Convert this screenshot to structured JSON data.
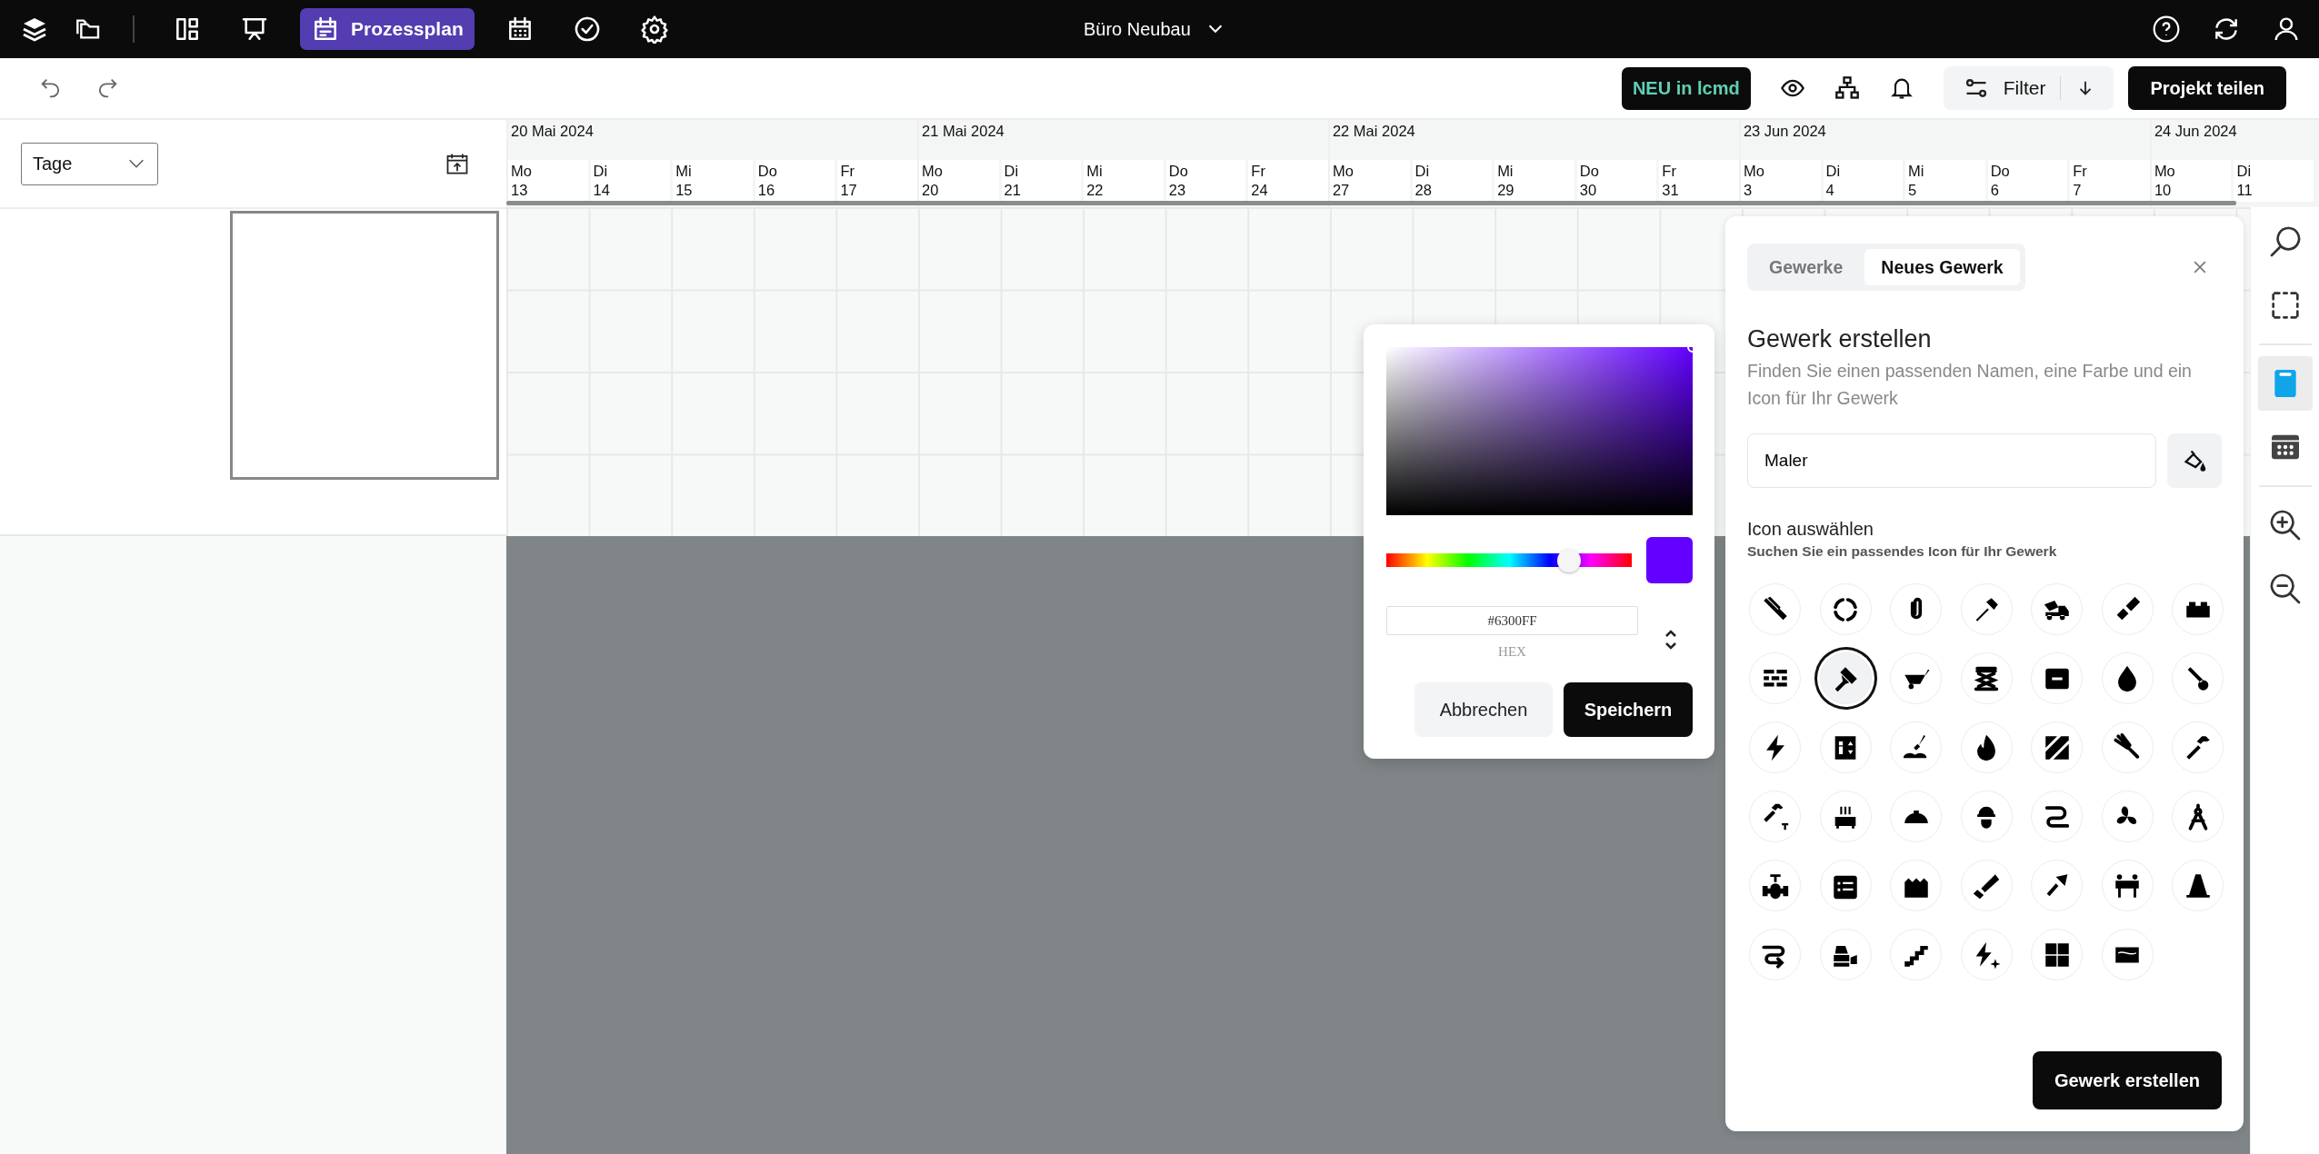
{
  "nav_tabs": [
    {
      "selected": false
    },
    {
      "selected": false
    },
    {
      "label": "Prozessplan",
      "selected": true
    },
    {
      "selected": false
    },
    {
      "selected": false
    },
    {
      "selected": false
    }
  ],
  "project": {
    "name": "Büro Neubau"
  },
  "toolbar": {
    "badge": "NEU in lcmd",
    "filter": "Filter",
    "share": "Projekt teilen"
  },
  "view_select": {
    "value": "Tage"
  },
  "timeline": {
    "weeks": [
      {
        "label": "20 Mai 2024",
        "days": [
          {
            "weekday": "Mo",
            "date": "13"
          },
          {
            "weekday": "Di",
            "date": "14"
          },
          {
            "weekday": "Mi",
            "date": "15"
          },
          {
            "weekday": "Do",
            "date": "16"
          },
          {
            "weekday": "Fr",
            "date": "17"
          }
        ]
      },
      {
        "label": "21 Mai 2024",
        "days": [
          {
            "weekday": "Mo",
            "date": "20"
          },
          {
            "weekday": "Di",
            "date": "21"
          },
          {
            "weekday": "Mi",
            "date": "22"
          },
          {
            "weekday": "Do",
            "date": "23"
          },
          {
            "weekday": "Fr",
            "date": "24"
          }
        ]
      },
      {
        "label": "22 Mai 2024",
        "days": [
          {
            "weekday": "Mo",
            "date": "27"
          },
          {
            "weekday": "Di",
            "date": "28"
          },
          {
            "weekday": "Mi",
            "date": "29"
          },
          {
            "weekday": "Do",
            "date": "30"
          },
          {
            "weekday": "Fr",
            "date": "31"
          }
        ]
      },
      {
        "label": "23 Jun 2024",
        "days": [
          {
            "weekday": "Mo",
            "date": "3"
          },
          {
            "weekday": "Di",
            "date": "4"
          },
          {
            "weekday": "Mi",
            "date": "5"
          },
          {
            "weekday": "Do",
            "date": "6"
          },
          {
            "weekday": "Fr",
            "date": "7"
          }
        ]
      },
      {
        "label": "24 Jun 2024",
        "days": [
          {
            "weekday": "Mo",
            "date": "10"
          },
          {
            "weekday": "Di",
            "date": "11"
          }
        ]
      }
    ]
  },
  "color_picker": {
    "hue_slider": {
      "level": 0.73
    },
    "hex": "#6300FF",
    "format": "HEX",
    "buttons": [
      "Abbrechen",
      "Speichern"
    ]
  },
  "panel": {
    "tabs": [
      {
        "label": "Gewerke",
        "selected": false
      },
      {
        "label": "Neues Gewerk",
        "selected": true
      }
    ],
    "title": "Gewerk erstellen",
    "description": "Finden Sie einen passenden Namen, eine Farbe und ein Icon für Ihr Gewerk",
    "name_field": {
      "value": "Maler"
    },
    "icon_section": {
      "title": "Icon auswählen",
      "hint": "Suchen Sie ein passendes Icon für Ihr Gewerk"
    },
    "icons": [
      {
        "selected": false
      },
      {
        "selected": false
      },
      {
        "selected": false
      },
      {
        "selected": false
      },
      {
        "selected": false
      },
      {
        "selected": false
      },
      {
        "selected": false
      },
      {
        "selected": false
      },
      {
        "selected": true
      },
      {
        "selected": false
      },
      {
        "selected": false
      },
      {
        "selected": false
      },
      {
        "selected": false
      },
      {
        "selected": false
      },
      {
        "selected": false
      },
      {
        "selected": false
      },
      {
        "selected": false
      },
      {
        "selected": false
      },
      {
        "selected": false
      },
      {
        "selected": false
      },
      {
        "selected": false
      },
      {
        "selected": false
      },
      {
        "selected": false
      },
      {
        "selected": false
      },
      {
        "selected": false
      },
      {
        "selected": false
      },
      {
        "selected": false
      },
      {
        "selected": false
      },
      {
        "selected": false
      },
      {
        "selected": false
      },
      {
        "selected": false
      },
      {
        "selected": false
      },
      {
        "selected": false
      },
      {
        "selected": false
      },
      {
        "selected": false
      },
      {
        "selected": false
      },
      {
        "selected": false
      },
      {
        "selected": false
      },
      {
        "selected": false
      },
      {
        "selected": false
      },
      {
        "selected": false
      }
    ],
    "submit": "Gewerk erstellen"
  },
  "tools": [
    {
      "selected": false
    },
    {
      "selected": false
    },
    {
      "selected": true
    },
    {
      "selected": false
    },
    {
      "selected": false
    },
    {
      "selected": false
    }
  ]
}
